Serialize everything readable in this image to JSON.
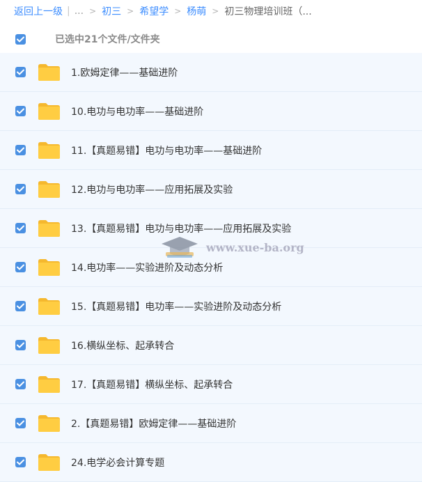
{
  "breadcrumb": {
    "back": "返回上一级",
    "ellipsis": "...",
    "items": [
      "初三",
      "希望学",
      "杨萌"
    ],
    "current": "初三物理培训班（..."
  },
  "selection": {
    "label": "已选中21个文件/文件夹",
    "checked": true
  },
  "files": [
    {
      "name": "1.欧姆定律——基础进阶",
      "checked": true
    },
    {
      "name": "10.电功与电功率——基础进阶",
      "checked": true
    },
    {
      "name": "11.【真题易错】电功与电功率——基础进阶",
      "checked": true
    },
    {
      "name": "12.电功与电功率——应用拓展及实验",
      "checked": true
    },
    {
      "name": "13.【真题易错】电功与电功率——应用拓展及实验",
      "checked": true
    },
    {
      "name": "14.电功率——实验进阶及动态分析",
      "checked": true
    },
    {
      "name": "15.【真题易错】电功率——实验进阶及动态分析",
      "checked": true
    },
    {
      "name": "16.横纵坐标、起承转合",
      "checked": true
    },
    {
      "name": "17.【真题易错】横纵坐标、起承转合",
      "checked": true
    },
    {
      "name": "2.【真题易错】欧姆定律——基础进阶",
      "checked": true
    },
    {
      "name": "24.电学必会计算专题",
      "checked": true
    }
  ],
  "watermark": {
    "text": "www.xue-ba.org",
    "icon": "graduation-cap-icon"
  },
  "colors": {
    "link": "#3b8cff",
    "checkbox": "#4a90e2",
    "folder": "#ffc93c",
    "row_bg": "#f3f8fe"
  }
}
